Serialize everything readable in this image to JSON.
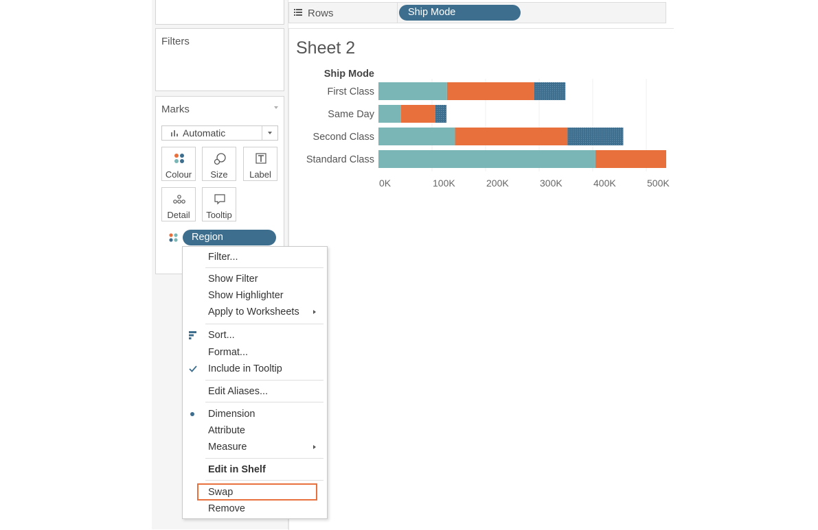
{
  "shelves": {
    "rows_label": "Rows",
    "rows_pill": "Ship Mode"
  },
  "filters": {
    "title": "Filters"
  },
  "marks": {
    "title": "Marks",
    "mark_type": "Automatic",
    "buttons": [
      "Colour",
      "Size",
      "Label",
      "Detail",
      "Tooltip"
    ],
    "colour_field": "Region"
  },
  "sheet": {
    "title": "Sheet 2"
  },
  "chart_data": {
    "type": "bar",
    "orientation": "horizontal",
    "stacked": true,
    "row_header": "Ship Mode",
    "categories": [
      "First Class",
      "Same Day",
      "Second Class",
      "Standard Class"
    ],
    "series": [
      {
        "values": [
          128000,
          42000,
          143000,
          405000
        ],
        "color": "#7ab6b6"
      },
      {
        "values": [
          163000,
          64000,
          210000,
          145000
        ],
        "color": "#e8703d"
      },
      {
        "values": [
          58000,
          21000,
          104000,
          0
        ],
        "color": "#3f6f8e"
      }
    ],
    "xticks": [
      "0K",
      "100K",
      "200K",
      "300K",
      "400K",
      "500K"
    ],
    "xlim": [
      0,
      550000
    ],
    "grid": true
  },
  "context_menu": {
    "items": [
      "Filter...",
      "Show Filter",
      "Show Highlighter",
      "Apply to Worksheets",
      "Sort...",
      "Format...",
      "Include in Tooltip",
      "Edit Aliases...",
      "Dimension",
      "Attribute",
      "Measure",
      "Edit in Shelf",
      "Swap",
      "Remove"
    ],
    "highlight_color": "#e8703d",
    "accent": "#3e6e8e"
  }
}
